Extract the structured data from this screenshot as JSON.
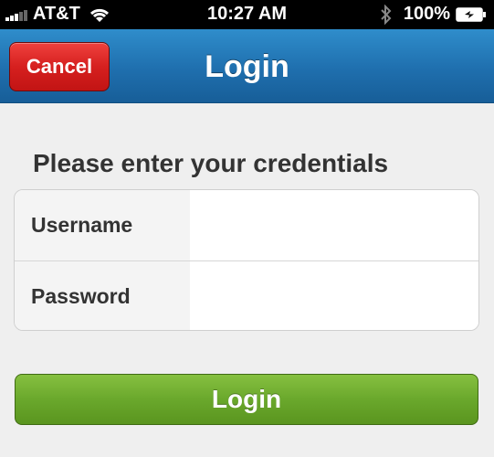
{
  "status_bar": {
    "carrier": "AT&T",
    "time": "10:27 AM",
    "battery_percent": "100%",
    "icons": [
      "signal-icon",
      "wifi-icon",
      "bluetooth-icon",
      "battery-icon"
    ]
  },
  "nav_bar": {
    "cancel_label": "Cancel",
    "title": "Login",
    "colors": {
      "bar": "#1f6fae",
      "cancel_button": "#d6201f"
    }
  },
  "form": {
    "heading": "Please enter your credentials",
    "fields": [
      {
        "label": "Username",
        "value": "",
        "placeholder": ""
      },
      {
        "label": "Password",
        "value": "",
        "placeholder": ""
      }
    ]
  },
  "actions": {
    "login_label": "Login",
    "color": "#6aa82c"
  }
}
